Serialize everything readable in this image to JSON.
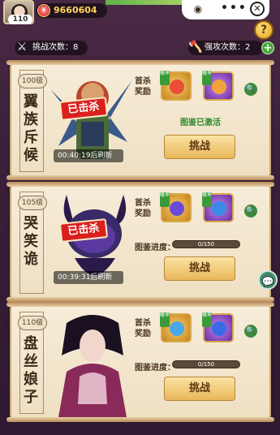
{
  "player": {
    "level": "110",
    "currency": "9660604"
  },
  "top_menu": {
    "icon_left": "eye-icon",
    "dots": "•••",
    "close": "✕"
  },
  "help_label": "?",
  "counters": {
    "challenge": {
      "label": "挑战次数：",
      "value": "8"
    },
    "strong": {
      "label": "强攻次数：",
      "value": "2"
    },
    "plus_label": "+"
  },
  "bosses": [
    {
      "level": "100级",
      "name": "翼族斥候",
      "killed_label": "已击杀",
      "timer": "00:40:19",
      "timer_suffix": "后刷新",
      "first_kill_label": "首杀奖励",
      "reward_tag": "概率",
      "status": "图鉴已激活",
      "fight_label": "挑战"
    },
    {
      "level": "105级",
      "name": "哭笑诡",
      "killed_label": "已击杀",
      "timer": "00:39:31",
      "timer_suffix": "后刷新",
      "first_kill_label": "首杀奖励",
      "reward_tag": "概率",
      "progress_label": "图鉴进度：",
      "progress_text": "0/150",
      "progress_fraction": 0,
      "fight_label": "挑战"
    },
    {
      "level": "110级",
      "name": "盘丝娘子",
      "first_kill_label": "首杀奖励",
      "reward_tag": "概率",
      "progress_label": "图鉴进度：",
      "progress_text": "0/150",
      "progress_fraction": 0,
      "fight_label": "挑战"
    }
  ],
  "colors": {
    "killed": "#d9201e",
    "activated": "#2c8a2c",
    "fight_button": "#e8b65a"
  }
}
